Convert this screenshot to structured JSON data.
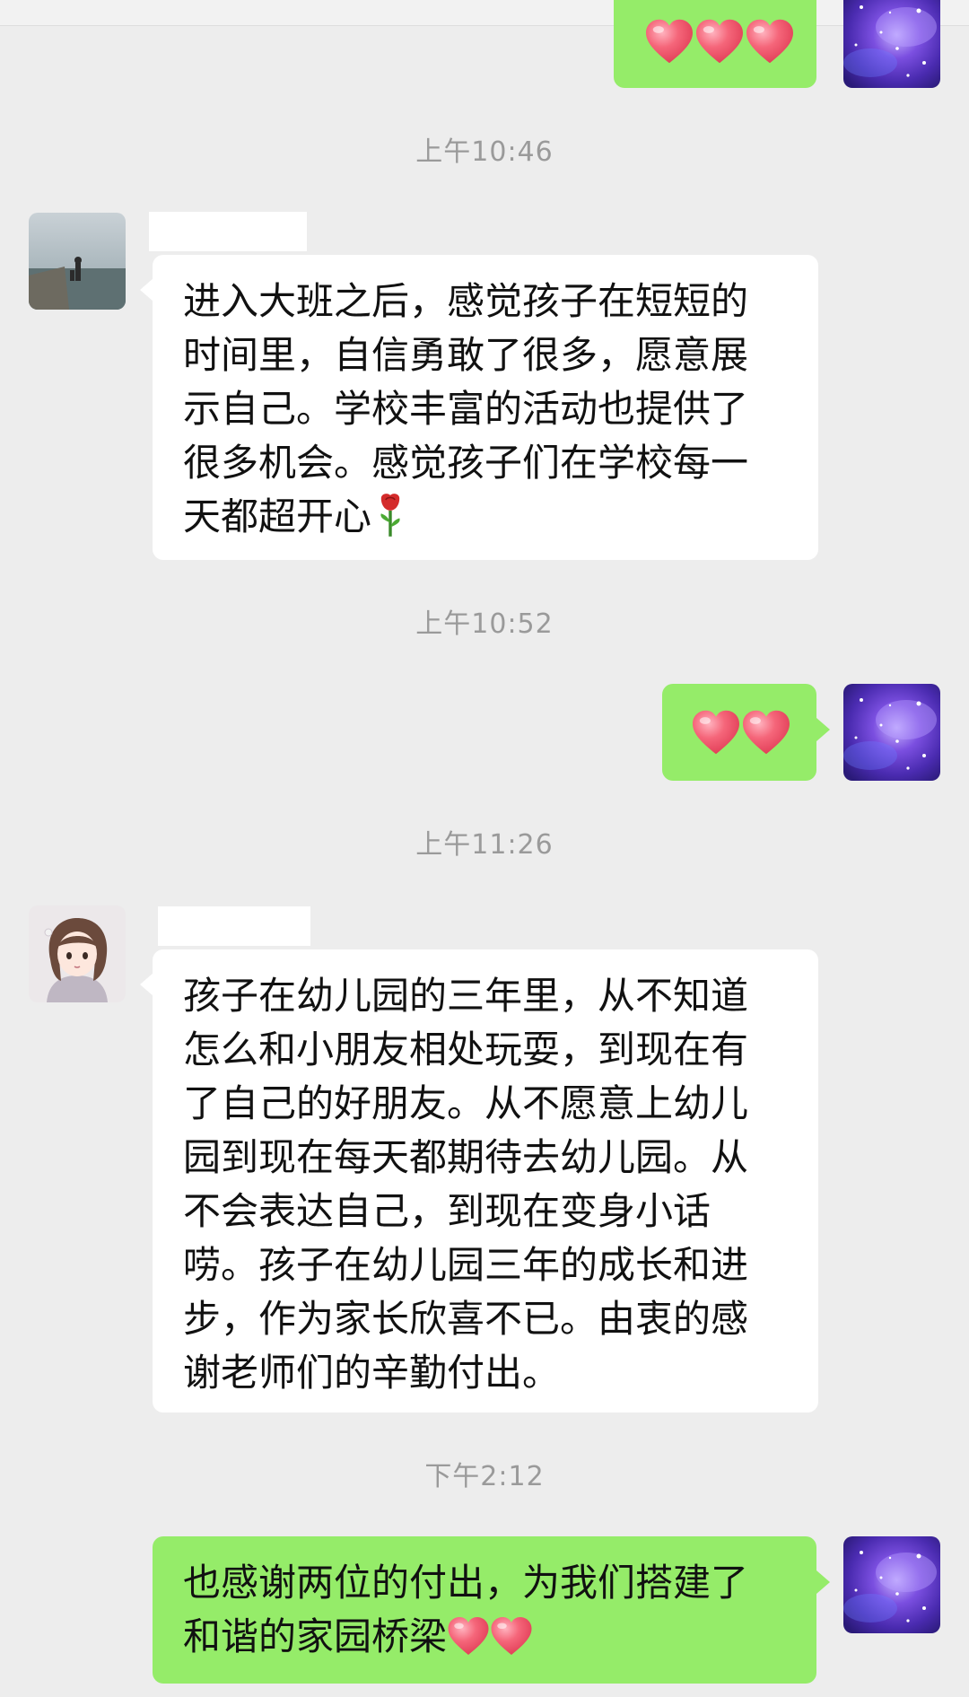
{
  "messages": {
    "m1": {
      "direction": "sent",
      "content": "hearts",
      "count": 3
    },
    "ts1": "上午10:46",
    "m2": {
      "direction": "received",
      "lines": [
        "进入大班之后，感觉孩子在短短的",
        "时间里，自信勇敢了很多，愿意展",
        "示自己。学校丰富的活动也提供了",
        "很多机会。感觉孩子们在学校每一",
        "天都超开心"
      ],
      "trailing_icon": "rose-icon"
    },
    "ts2": "上午10:52",
    "m3": {
      "direction": "sent",
      "content": "hearts",
      "count": 2
    },
    "ts3": "上午11:26",
    "m4": {
      "direction": "received",
      "lines": [
        "孩子在幼儿园的三年里，从不知道",
        "怎么和小朋友相处玩耍，到现在有",
        "了自己的好朋友。从不愿意上幼儿",
        "园到现在每天都期待去幼儿园。从",
        "不会表达自己，到现在变身小话",
        "唠。孩子在幼儿园三年的成长和进",
        "步，作为家长欣喜不已。由衷的感",
        "谢老师们的辛勤付出。"
      ]
    },
    "ts4": "下午2:12",
    "m5": {
      "direction": "sent",
      "lines": [
        "也感谢两位的付出，为我们搭建了",
        "和谐的家园桥梁"
      ],
      "trailing_icons": [
        "heart-icon",
        "heart-icon"
      ]
    }
  },
  "colors": {
    "background": "#ededed",
    "sent_bubble": "#95ec69",
    "received_bubble": "#ffffff",
    "timestamp": "#9a9a9a",
    "heart": "#f0566b"
  }
}
